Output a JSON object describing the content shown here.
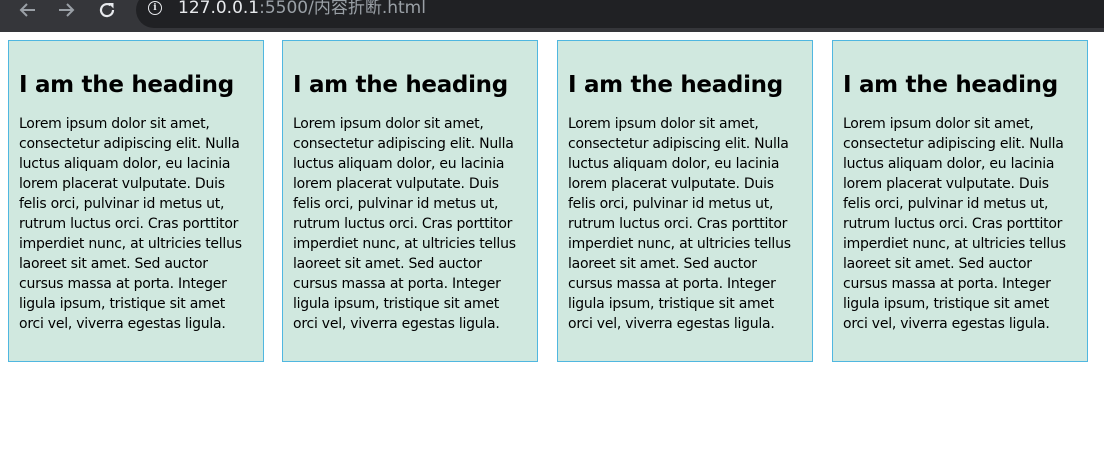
{
  "browser": {
    "url_host": "127.0.0.1",
    "url_rest": ":5500/内容折断.html"
  },
  "boxes": [
    {
      "heading": "I am the heading",
      "text": "Lorem ipsum dolor sit amet, consectetur adipiscing elit. Nulla luctus aliquam dolor, eu lacinia lorem placerat vulputate. Duis felis orci, pulvinar id metus ut, rutrum luctus orci. Cras porttitor imperdiet nunc, at ultricies tellus laoreet sit amet. Sed auctor cursus massa at porta. Integer ligula ipsum, tristique sit amet orci vel, viverra egestas ligula."
    },
    {
      "heading": "I am the heading",
      "text": "Lorem ipsum dolor sit amet, consectetur adipiscing elit. Nulla luctus aliquam dolor, eu lacinia lorem placerat vulputate. Duis felis orci, pulvinar id metus ut, rutrum luctus orci. Cras porttitor imperdiet nunc, at ultricies tellus laoreet sit amet. Sed auctor cursus massa at porta. Integer ligula ipsum, tristique sit amet orci vel, viverra egestas ligula."
    },
    {
      "heading": "I am the heading",
      "text": "Lorem ipsum dolor sit amet, consectetur adipiscing elit. Nulla luctus aliquam dolor, eu lacinia lorem placerat vulputate. Duis felis orci, pulvinar id metus ut, rutrum luctus orci. Cras porttitor imperdiet nunc, at ultricies tellus laoreet sit amet. Sed auctor cursus massa at porta. Integer ligula ipsum, tristique sit amet orci vel, viverra egestas ligula."
    },
    {
      "heading": "I am the heading",
      "text": "Lorem ipsum dolor sit amet, consectetur adipiscing elit. Nulla luctus aliquam dolor, eu lacinia lorem placerat vulputate. Duis felis orci, pulvinar id metus ut, rutrum luctus orci. Cras porttitor imperdiet nunc, at ultricies tellus laoreet sit amet. Sed auctor cursus massa at porta. Integer ligula ipsum, tristique sit amet orci vel, viverra egestas ligula."
    }
  ],
  "icons": {
    "back": "back-arrow-icon",
    "forward": "forward-arrow-icon",
    "reload": "reload-icon",
    "info": "info-icon"
  },
  "colors": {
    "box_background": "#d0e8df",
    "box_border": "#50b7e0",
    "toolbar": "#35363a",
    "omnibox": "#202124"
  }
}
